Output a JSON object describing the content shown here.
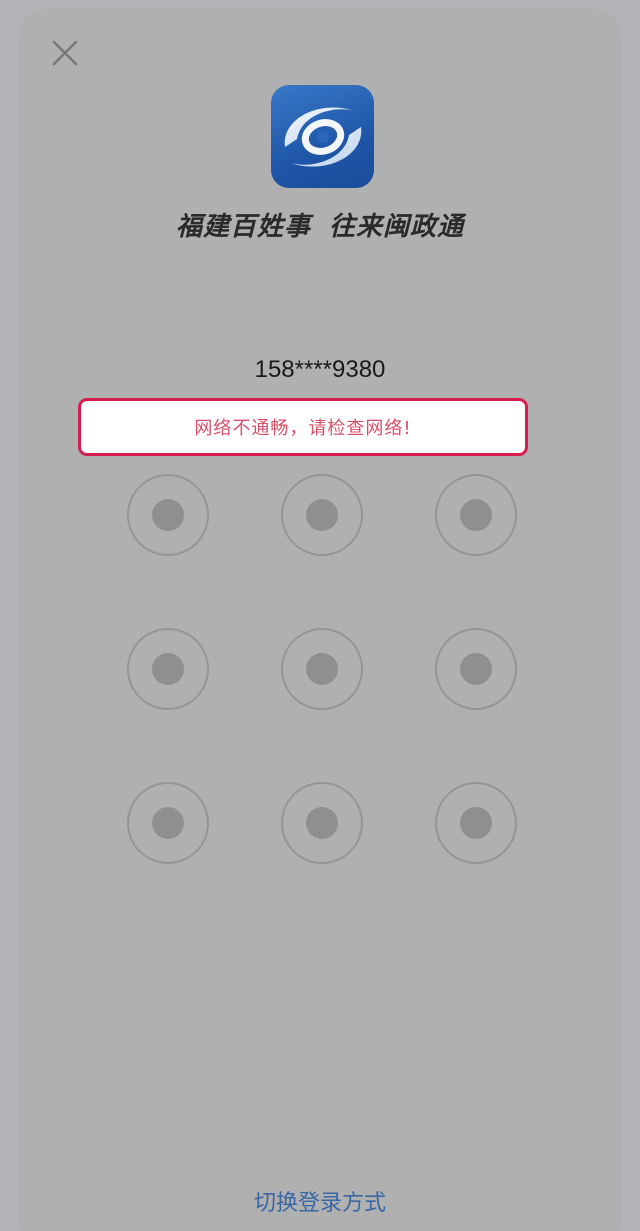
{
  "header": {
    "close_icon": "close-icon"
  },
  "app": {
    "logo_icon": "app-logo-icon",
    "slogan_part1": "福建百姓事",
    "slogan_part2": "往来闽政通"
  },
  "account": {
    "masked_phone": "158****9380"
  },
  "alert": {
    "message": "网络不通畅，请检查网络!",
    "border_color": "#d51e4e",
    "text_color": "#d8506a"
  },
  "pattern": {
    "rows": 3,
    "cols": 3,
    "nodes": [
      "1",
      "2",
      "3",
      "4",
      "5",
      "6",
      "7",
      "8",
      "9"
    ]
  },
  "footer": {
    "switch_label": "切换登录方式",
    "link_color": "#3966a5"
  }
}
